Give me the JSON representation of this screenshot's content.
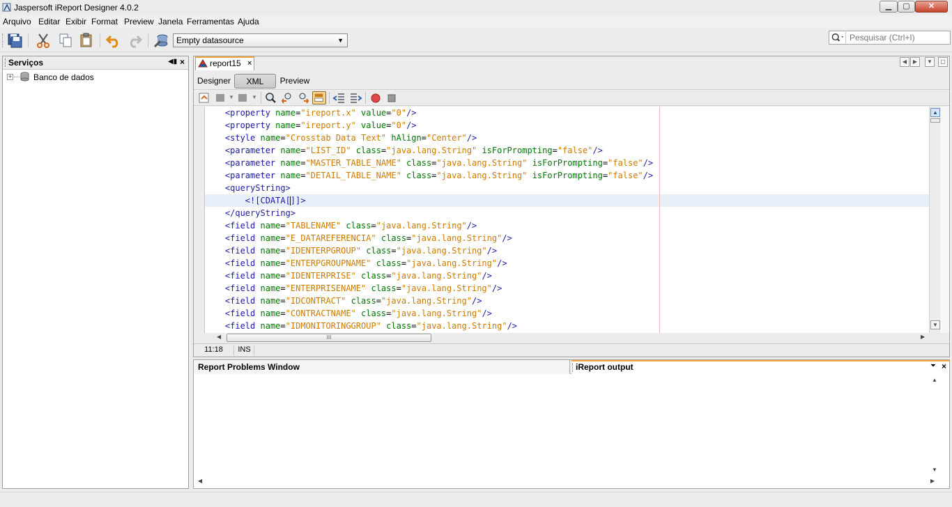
{
  "window": {
    "title": "Jaspersoft iReport Designer 4.0.2",
    "controls": {
      "minimize": "▁",
      "maximize": "▢",
      "close": "✕"
    }
  },
  "menu": [
    {
      "label": "Arquivo"
    },
    {
      "label": "Editar"
    },
    {
      "label": "Exibir"
    },
    {
      "label": "Format"
    },
    {
      "label": "Preview"
    },
    {
      "label": "Janela"
    },
    {
      "label": "Ferramentas"
    },
    {
      "label": "Ajuda"
    }
  ],
  "toolbar": {
    "datasource": "Empty datasource",
    "search_placeholder": "Pesquisar (Ctrl+I)"
  },
  "services_panel": {
    "title": "Serviços",
    "tree": [
      {
        "label": "Banco de dados",
        "expander": "+"
      }
    ]
  },
  "editor": {
    "document_tab": "report15",
    "view_tabs": [
      {
        "label": "Designer"
      },
      {
        "label": "XML"
      },
      {
        "label": "Preview"
      }
    ],
    "selected_view": "XML",
    "code_lines": [
      "    <property name=\"ireport.x\" value=\"0\"/>",
      "    <property name=\"ireport.y\" value=\"0\"/>",
      "    <style name=\"Crosstab Data Text\" hAlign=\"Center\"/>",
      "    <parameter name=\"LIST_ID\" class=\"java.lang.String\" isForPrompting=\"false\"/>",
      "    <parameter name=\"MASTER_TABLE_NAME\" class=\"java.lang.String\" isForPrompting=\"false\"/>",
      "    <parameter name=\"DETAIL_TABLE_NAME\" class=\"java.lang.String\" isForPrompting=\"false\"/>",
      "    <queryString>",
      "        <![CDATA[]]>",
      "    </queryString>",
      "    <field name=\"TABLENAME\" class=\"java.lang.String\"/>",
      "    <field name=\"E_DATAREFERENCIA\" class=\"java.lang.String\"/>",
      "    <field name=\"IDENTERPGROUP\" class=\"java.lang.String\"/>",
      "    <field name=\"ENTERPGROUPNAME\" class=\"java.lang.String\"/>",
      "    <field name=\"IDENTERPRISE\" class=\"java.lang.String\"/>",
      "    <field name=\"ENTERPRISENAME\" class=\"java.lang.String\"/>",
      "    <field name=\"IDCONTRACT\" class=\"java.lang.String\"/>",
      "    <field name=\"CONTRACTNAME\" class=\"java.lang.String\"/>",
      "    <field name=\"IDMONITORINGGROUP\" class=\"java.lang.String\"/>"
    ],
    "current_line_index": 7,
    "cursor_position": "11:18",
    "insert_mode": "INS",
    "hscroll_thumb_label": "III"
  },
  "bottom_panel": {
    "tabs": [
      {
        "label": "Report Problems Window"
      },
      {
        "label": "iReport output"
      }
    ],
    "active_tab": "iReport output"
  },
  "colors": {
    "tag": "#1a1aa6",
    "attribute": "#007700",
    "value": "#ce7b00",
    "active_tab_accent": "#f2a83c",
    "current_line": "#e9eff8",
    "margin_line": "#f2b6b6"
  }
}
